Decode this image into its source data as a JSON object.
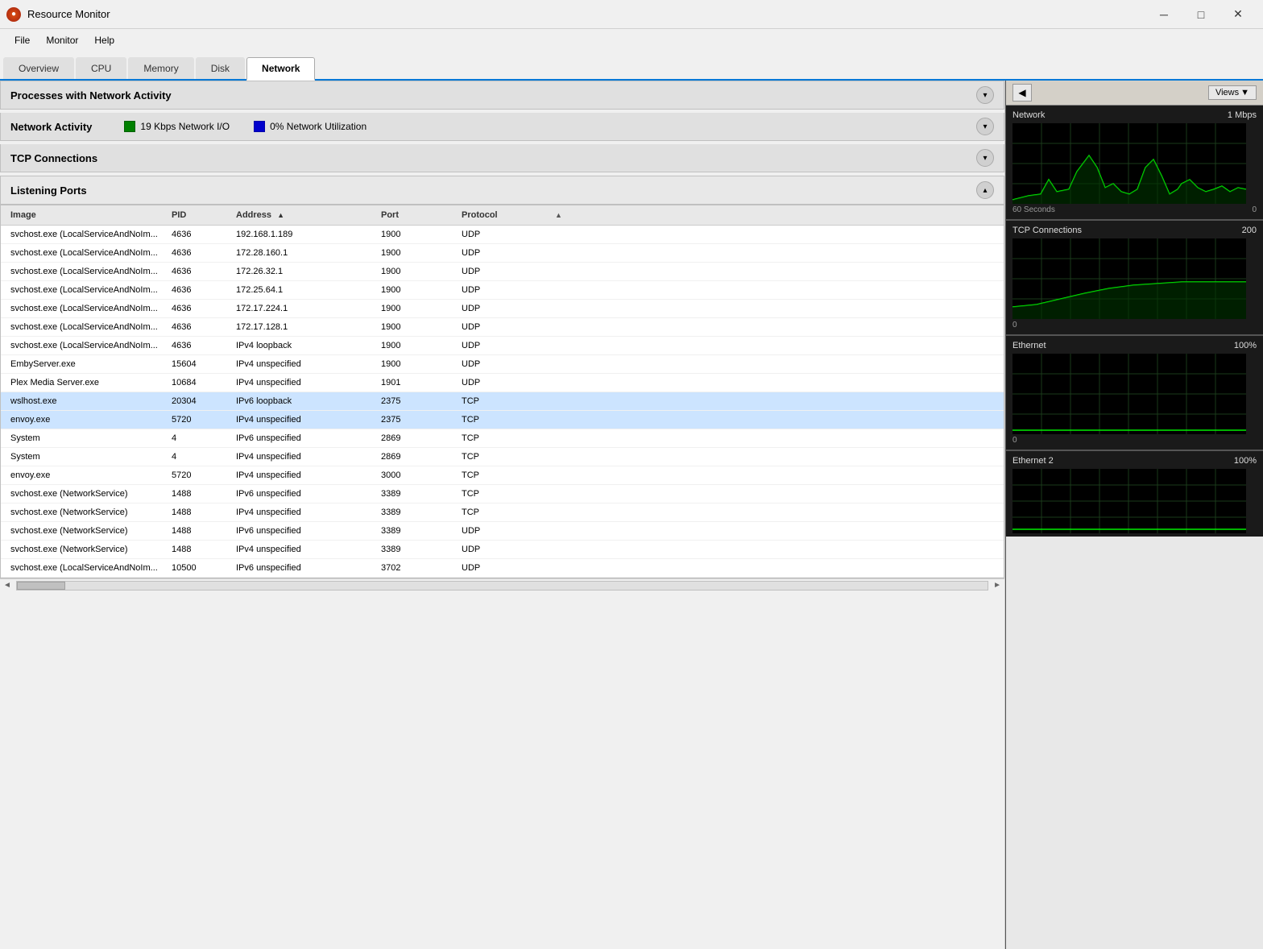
{
  "titlebar": {
    "title": "Resource Monitor",
    "minimize": "─",
    "maximize": "□",
    "close": "✕"
  },
  "menubar": {
    "items": [
      "File",
      "Monitor",
      "Help"
    ]
  },
  "tabs": [
    {
      "label": "Overview",
      "active": false
    },
    {
      "label": "CPU",
      "active": false
    },
    {
      "label": "Memory",
      "active": false
    },
    {
      "label": "Disk",
      "active": false
    },
    {
      "label": "Network",
      "active": true
    }
  ],
  "sections": {
    "processes": {
      "title": "Processes with Network Activity",
      "collapsed": false
    },
    "network_activity": {
      "title": "Network Activity",
      "stat1": "19 Kbps Network I/O",
      "stat2": "0% Network Utilization",
      "collapsed": false
    },
    "tcp": {
      "title": "TCP Connections",
      "collapsed": false
    },
    "listening": {
      "title": "Listening Ports",
      "collapsed": false
    }
  },
  "table": {
    "headers": {
      "image": "Image",
      "pid": "PID",
      "address": "Address",
      "port": "Port",
      "protocol": "Protocol"
    },
    "rows": [
      {
        "image": "svchost.exe (LocalServiceAndNoIm...",
        "pid": "4636",
        "address": "192.168.1.189",
        "port": "1900",
        "protocol": "UDP",
        "selected": false
      },
      {
        "image": "svchost.exe (LocalServiceAndNoIm...",
        "pid": "4636",
        "address": "172.28.160.1",
        "port": "1900",
        "protocol": "UDP",
        "selected": false
      },
      {
        "image": "svchost.exe (LocalServiceAndNoIm...",
        "pid": "4636",
        "address": "172.26.32.1",
        "port": "1900",
        "protocol": "UDP",
        "selected": false
      },
      {
        "image": "svchost.exe (LocalServiceAndNoIm...",
        "pid": "4636",
        "address": "172.25.64.1",
        "port": "1900",
        "protocol": "UDP",
        "selected": false
      },
      {
        "image": "svchost.exe (LocalServiceAndNoIm...",
        "pid": "4636",
        "address": "172.17.224.1",
        "port": "1900",
        "protocol": "UDP",
        "selected": false
      },
      {
        "image": "svchost.exe (LocalServiceAndNoIm...",
        "pid": "4636",
        "address": "172.17.128.1",
        "port": "1900",
        "protocol": "UDP",
        "selected": false
      },
      {
        "image": "svchost.exe (LocalServiceAndNoIm...",
        "pid": "4636",
        "address": "IPv4 loopback",
        "port": "1900",
        "protocol": "UDP",
        "selected": false
      },
      {
        "image": "EmbyServer.exe",
        "pid": "15604",
        "address": "IPv4 unspecified",
        "port": "1900",
        "protocol": "UDP",
        "selected": false
      },
      {
        "image": "Plex Media Server.exe",
        "pid": "10684",
        "address": "IPv4 unspecified",
        "port": "1901",
        "protocol": "UDP",
        "selected": false
      },
      {
        "image": "wslhost.exe",
        "pid": "20304",
        "address": "IPv6 loopback",
        "port": "2375",
        "protocol": "TCP",
        "selected": true
      },
      {
        "image": "envoy.exe",
        "pid": "5720",
        "address": "IPv4 unspecified",
        "port": "2375",
        "protocol": "TCP",
        "selected": true
      },
      {
        "image": "System",
        "pid": "4",
        "address": "IPv6 unspecified",
        "port": "2869",
        "protocol": "TCP",
        "selected": false
      },
      {
        "image": "System",
        "pid": "4",
        "address": "IPv4 unspecified",
        "port": "2869",
        "protocol": "TCP",
        "selected": false
      },
      {
        "image": "envoy.exe",
        "pid": "5720",
        "address": "IPv4 unspecified",
        "port": "3000",
        "protocol": "TCP",
        "selected": false
      },
      {
        "image": "svchost.exe (NetworkService)",
        "pid": "1488",
        "address": "IPv6 unspecified",
        "port": "3389",
        "protocol": "TCP",
        "selected": false
      },
      {
        "image": "svchost.exe (NetworkService)",
        "pid": "1488",
        "address": "IPv4 unspecified",
        "port": "3389",
        "protocol": "TCP",
        "selected": false
      },
      {
        "image": "svchost.exe (NetworkService)",
        "pid": "1488",
        "address": "IPv6 unspecified",
        "port": "3389",
        "protocol": "UDP",
        "selected": false
      },
      {
        "image": "svchost.exe (NetworkService)",
        "pid": "1488",
        "address": "IPv4 unspecified",
        "port": "3389",
        "protocol": "UDP",
        "selected": false
      },
      {
        "image": "svchost.exe (LocalServiceAndNoIm...",
        "pid": "10500",
        "address": "IPv6 unspecified",
        "port": "3702",
        "protocol": "UDP",
        "selected": false
      }
    ]
  },
  "right_panel": {
    "views_label": "Views",
    "charts": [
      {
        "label": "Network",
        "value": "1 Mbps",
        "time_label": "60 Seconds",
        "time_value": "0",
        "color": "#00cc00"
      },
      {
        "label": "TCP Connections",
        "value": "200",
        "color": "#00cc00"
      },
      {
        "label": "Ethernet",
        "value": "100%",
        "color": "#00cc00"
      },
      {
        "label": "Ethernet 2",
        "value": "100%",
        "color": "#00cc00"
      }
    ]
  }
}
